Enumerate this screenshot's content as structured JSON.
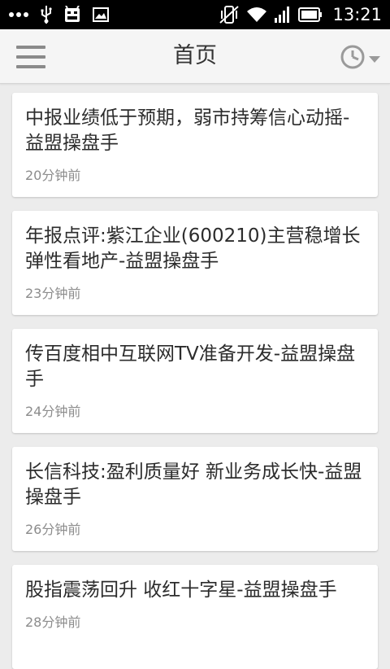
{
  "status_bar": {
    "time": "13:21"
  },
  "app_bar": {
    "title": "首页"
  },
  "feed": {
    "items": [
      {
        "title": "中报业绩低于预期，弱市持筹信心动摇-益盟操盘手",
        "time": "20分钟前"
      },
      {
        "title": "年报点评:紫江企业(600210)主营稳增长 弹性看地产-益盟操盘手",
        "time": "23分钟前"
      },
      {
        "title": "传百度相中互联网TV准备开发-益盟操盘手",
        "time": "24分钟前"
      },
      {
        "title": "长信科技:盈利质量好 新业务成长快-益盟操盘手",
        "time": "26分钟前"
      },
      {
        "title": "股指震荡回升 收红十字星-益盟操盘手",
        "time": "28分钟前"
      }
    ]
  },
  "icons": {
    "notifications": [
      "more-dots-icon",
      "usb-icon",
      "android-debug-icon",
      "image-icon"
    ],
    "system": [
      "vibrate-off-icon",
      "wifi-icon",
      "signal-icon",
      "battery-icon"
    ],
    "menu": "hamburger-menu-icon",
    "history": "clock-icon"
  },
  "colors": {
    "status_bar_bg": "#000000",
    "app_bar_bg": "#f5f5f5",
    "page_bg": "#ececec",
    "card_bg": "#ffffff",
    "title_text": "#2c2c2c",
    "meta_text": "#8c8c8c"
  }
}
